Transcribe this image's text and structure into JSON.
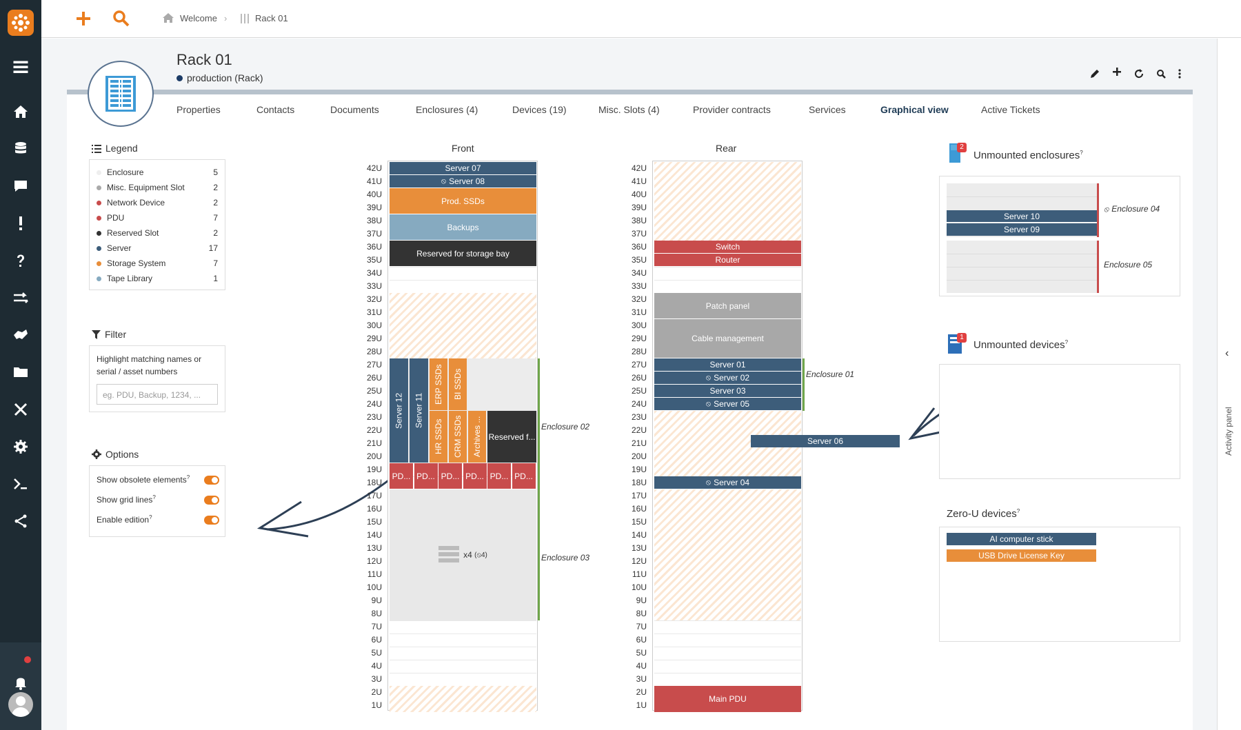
{
  "nav": {
    "items": [
      "menu-icon",
      "home-icon",
      "database-icon",
      "chat-icon",
      "alert-icon",
      "help-icon",
      "transfer-icon",
      "handshake-icon",
      "folder-icon",
      "tools-icon",
      "gear-icon",
      "terminal-icon",
      "share-icon"
    ]
  },
  "breadcrumb": {
    "home": "Welcome",
    "current": "Rack 01"
  },
  "header": {
    "title": "Rack 01",
    "status": "production",
    "type": "(Rack)"
  },
  "tabs": [
    "Properties",
    "Contacts",
    "Documents",
    "Enclosures (4)",
    "Devices (19)",
    "Misc. Slots (4)",
    "Provider contracts",
    "Services",
    "Graphical view",
    "Active Tickets"
  ],
  "active_tab": "Graphical view",
  "legend": {
    "title": "Legend",
    "items": [
      {
        "label": "Enclosure",
        "count": "5",
        "color": "#eeeeee"
      },
      {
        "label": "Misc. Equipment Slot",
        "count": "2",
        "color": "#aaaaaa"
      },
      {
        "label": "Network Device",
        "count": "2",
        "color": "#c84c4c"
      },
      {
        "label": "PDU",
        "count": "7",
        "color": "#c84c4c"
      },
      {
        "label": "Reserved Slot",
        "count": "2",
        "color": "#333333"
      },
      {
        "label": "Server",
        "count": "17",
        "color": "#3d5d7a"
      },
      {
        "label": "Storage System",
        "count": "7",
        "color": "#e88e3a"
      },
      {
        "label": "Tape Library",
        "count": "1",
        "color": "#86aac0"
      }
    ]
  },
  "filter": {
    "title": "Filter",
    "hint": "Highlight matching names or serial / asset numbers",
    "placeholder": "eg. PDU, Backup, 1234, ..."
  },
  "options": {
    "title": "Options",
    "items": [
      "Show obsolete elements",
      "Show grid lines",
      "Enable edition"
    ]
  },
  "rack": {
    "front_title": "Front",
    "rear_title": "Rear",
    "units": [
      "42U",
      "41U",
      "40U",
      "39U",
      "38U",
      "37U",
      "36U",
      "35U",
      "34U",
      "33U",
      "32U",
      "31U",
      "30U",
      "29U",
      "28U",
      "27U",
      "26U",
      "25U",
      "24U",
      "23U",
      "22U",
      "21U",
      "20U",
      "19U",
      "18U",
      "17U",
      "16U",
      "15U",
      "14U",
      "13U",
      "12U",
      "11U",
      "10U",
      "9U",
      "8U",
      "7U",
      "6U",
      "5U",
      "4U",
      "3U",
      "2U",
      "1U"
    ],
    "front": {
      "server07": "Server 07",
      "server08": "Server 08",
      "prod_ssds": "Prod. SSDs",
      "backups": "Backups",
      "reserved_storage": "Reserved for storage bay",
      "server12": "Server 12",
      "server11": "Server 11",
      "erp_ssds": "ERP SSDs",
      "bi_ssds": "BI SSDs",
      "hr_ssds": "HR SSDs",
      "crm_ssds": "CRM SSDs",
      "archives": "Archives ...",
      "reserved_f": "Reserved f...",
      "pdus": [
        "PD...",
        "PD...",
        "PD...",
        "PD...",
        "PD...",
        "PD..."
      ],
      "enc03_count": "x4",
      "enc03_hidden": "4",
      "enclosure02": "Enclosure 02",
      "enclosure03": "Enclosure 03"
    },
    "rear": {
      "switch": "Switch",
      "router": "Router",
      "patch_panel": "Patch panel",
      "cable_mgmt": "Cable management",
      "server01": "Server 01",
      "server02": "Server 02",
      "server03": "Server 03",
      "server05": "Server 05",
      "server06": "Server 06",
      "server04": "Server 04",
      "main_pdu": "Main PDU",
      "enclosure01": "Enclosure 01"
    }
  },
  "unmounted_enclosures": {
    "title": "Unmounted enclosures",
    "badge": "2",
    "server10": "Server 10",
    "server09": "Server 09",
    "enclosure04": "Enclosure 04",
    "enclosure05": "Enclosure 05"
  },
  "unmounted_devices": {
    "title": "Unmounted devices",
    "badge": "1"
  },
  "zero_u": {
    "title": "Zero-U devices",
    "items": [
      "AI computer stick",
      "USB Drive License Key"
    ]
  },
  "activity_panel": "Activity panel"
}
